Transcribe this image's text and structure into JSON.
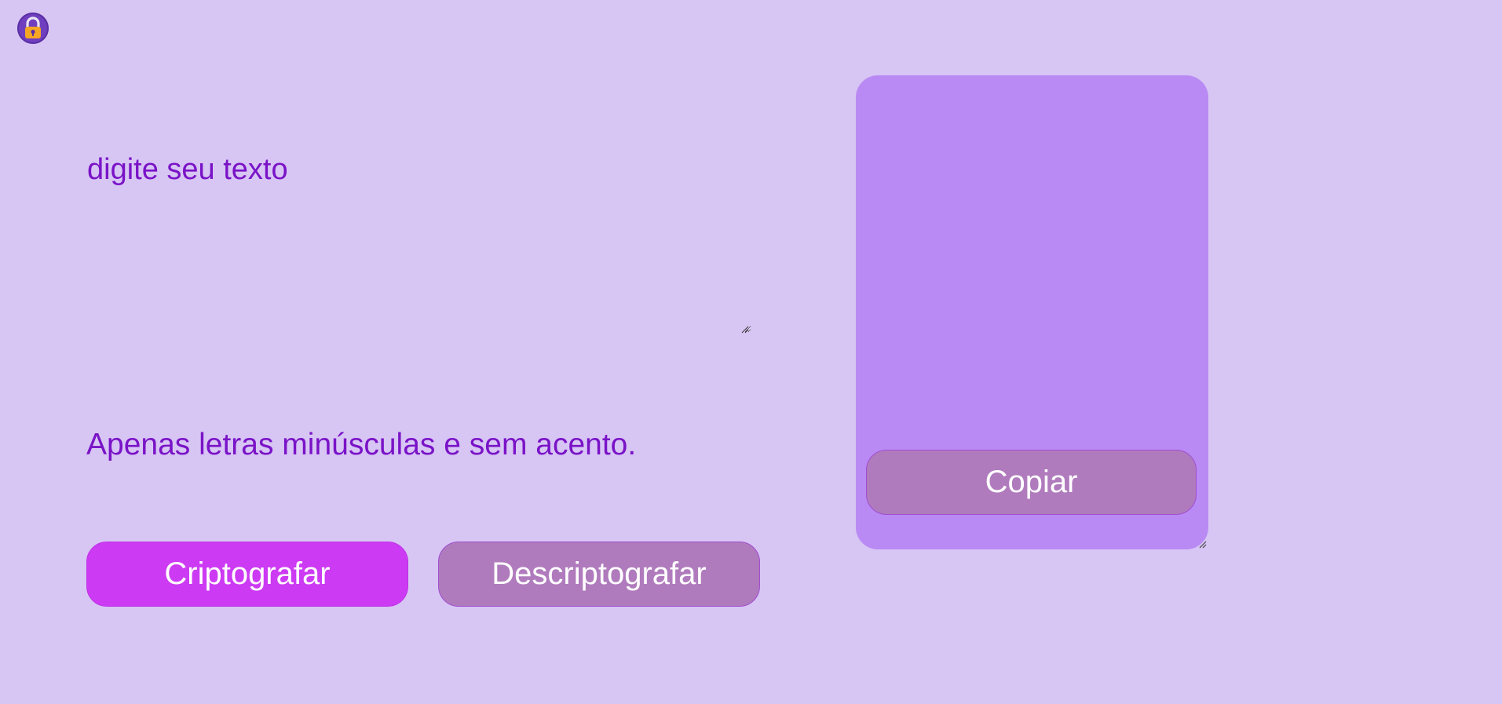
{
  "logo": {
    "icon": "lock-icon",
    "colors": {
      "circle": "#6f3fbf",
      "lock_body": "#f5a623",
      "shackle": "#e9e4f5"
    }
  },
  "encoder": {
    "input_placeholder": "digite seu texto",
    "input_value": "",
    "hint_text": "Apenas letras minúsculas e sem acento."
  },
  "buttons": {
    "encrypt_label": "Criptografar",
    "decrypt_label": "Descriptografar",
    "copy_label": "Copiar"
  },
  "output": {
    "text": ""
  },
  "colors": {
    "background": "#d7c5f4",
    "accent_text": "#7a13c7",
    "encrypt_button": "#cc3af3",
    "secondary_button": "#b07bbd",
    "output_panel": "#b98af4",
    "button_text": "#ffffff"
  }
}
